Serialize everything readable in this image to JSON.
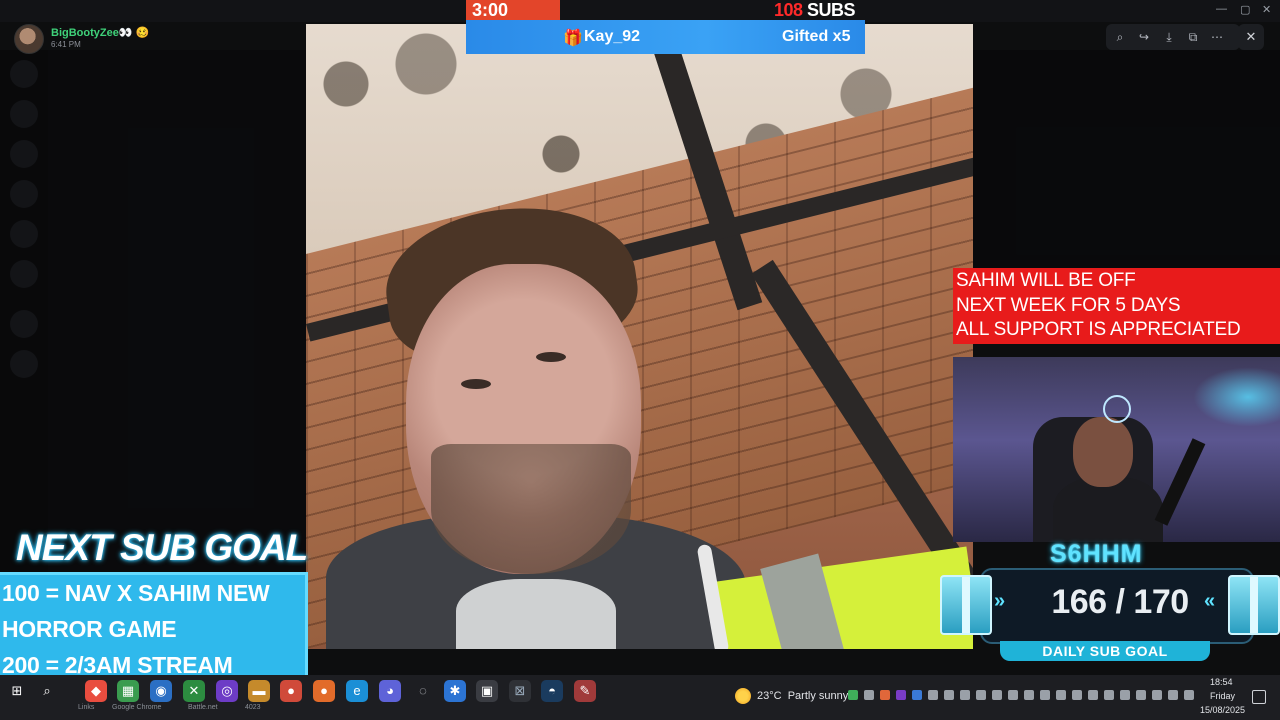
{
  "viewer": {
    "username": "BigBootyZee👀 🥴",
    "timestamp": "6:41 PM",
    "tools": [
      "zoom-icon",
      "forward-icon",
      "download-icon",
      "open-external-icon",
      "more-icon"
    ],
    "close_icon": "✕"
  },
  "stream_overlay": {
    "timer": "3:00",
    "subs_number": "108",
    "subs_suffix": " SUBS",
    "alert_user": "Kay_92",
    "alert_gift": "Gifted x5",
    "announcement": [
      "SAHIM WILL BE OFF",
      "NEXT WEEK FOR 5 DAYS",
      "ALL SUPPORT IS APPRECIATED"
    ],
    "channel_name": "S6HHM",
    "daily_goal_value": "166 / 170",
    "daily_goal_label": "DAILY SUB GOAL",
    "next_goal_title": "NEXT SUB GOAL",
    "next_goal_lines": [
      "100 = NAV X SAHIM NEW",
      "HORROR GAME",
      "200 = 2/3AM STREAM"
    ]
  },
  "taskbar": {
    "weather_temp": "23°C",
    "weather_desc": "Partly sunny",
    "time": "18:54",
    "day": "Friday",
    "date": "15/08/2025",
    "labels": [
      "Links",
      "Google Chrome",
      "Battle.net",
      "4023"
    ]
  },
  "colors": {
    "accent_cyan": "#5fe3ff",
    "alert_red": "#e81b1b",
    "goal_blue": "#2fb9ec"
  }
}
